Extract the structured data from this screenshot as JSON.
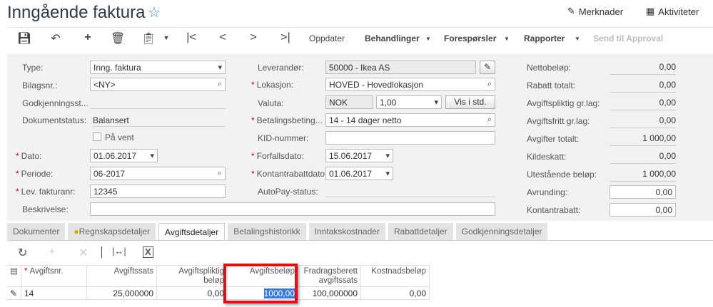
{
  "header": {
    "title": "Inngående faktura",
    "notes": "Merknader",
    "activities": "Aktiviteter"
  },
  "toolbar": {
    "refresh": "Oppdater",
    "actions": "Behandlinger",
    "inquiries": "Forespørsler",
    "reports": "Rapporter",
    "send": "Send til Approval"
  },
  "form": {
    "type_label": "Type:",
    "type": "Inng. faktura",
    "ref_label": "Bilagsnr.:",
    "ref": "<NY>",
    "approval_label": "Godkjenningsst...",
    "status_label": "Dokumentstatus:",
    "status": "Balansert",
    "hold_label": "På vent",
    "date_label": "Dato:",
    "date": "01.06.2017",
    "period_label": "Periode:",
    "period": "06-2017",
    "vendorref_label": "Lev. fakturanr:",
    "vendorref": "12345",
    "desc_label": "Beskrivelse:",
    "vendor_label": "Leverandør:",
    "vendor": "50000 - Ikea AS",
    "location_label": "Lokasjon:",
    "location": "HOVED - Hovedlokasjon",
    "currency_label": "Valuta:",
    "currency": "NOK",
    "rate": "1,00",
    "view_base": "Vis i std.",
    "terms_label": "Betalingsbeting...",
    "terms": "14 - 14 dager netto",
    "kid_label": "KID-nummer:",
    "due_label": "Forfallsdato:",
    "due": "15.06.2017",
    "discdate_label": "Kontantrabattdato:",
    "discdate": "01.06.2017",
    "autopay_label": "AutoPay-status:",
    "totals": [
      {
        "label": "Nettobeløp:",
        "value": "0,00"
      },
      {
        "label": "Rabatt totalt:",
        "value": "0,00"
      },
      {
        "label": "Avgiftspliktig gr.lag:",
        "value": "0,00"
      },
      {
        "label": "Avgiftsfritt gr.lag:",
        "value": "0,00"
      },
      {
        "label": "Avgifter totalt:",
        "value": "1 000,00"
      },
      {
        "label": "Kildeskatt:",
        "value": "0,00"
      },
      {
        "label": "Utestående beløp:",
        "value": "1 000,00"
      },
      {
        "label": "Avrunding:",
        "value": "0,00"
      },
      {
        "label": "Kontantrabatt:",
        "value": "0,00"
      }
    ]
  },
  "tabs": [
    "Dokumenter",
    "Regnskapsdetaljer",
    "Avgiftsdetaljer",
    "Betalingshistorikk",
    "Inntakskostnader",
    "Rabattdetaljer",
    "Godkjenningsdetaljer"
  ],
  "grid": {
    "headers": [
      "Avgiftsnr.",
      "Avgiftssats",
      "Avgiftspliktig beløp",
      "Avgiftsbeløp",
      "Fradragsberett avgiftssats",
      "Kostnadsbeløp"
    ],
    "rows": [
      [
        "14",
        "25,000000",
        "0,00",
        "1000,00",
        "100,000000",
        "0,00"
      ]
    ]
  }
}
